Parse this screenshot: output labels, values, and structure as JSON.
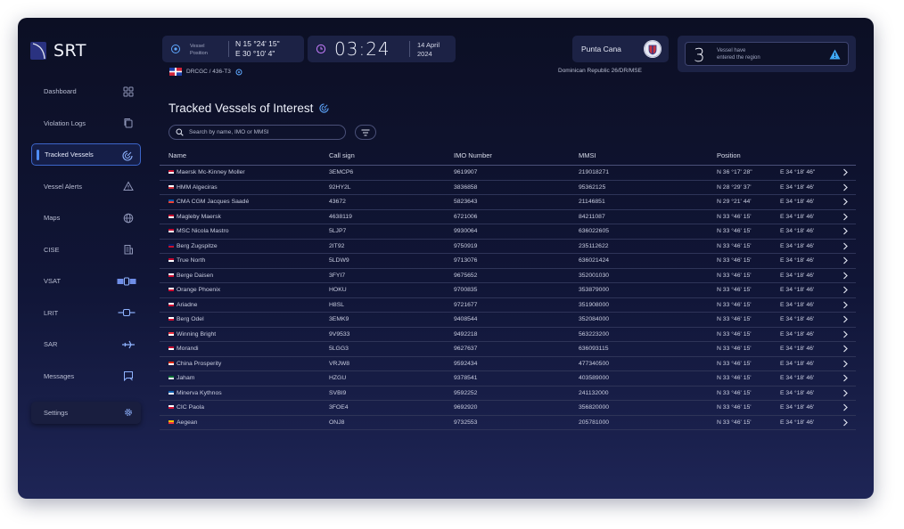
{
  "app": {
    "brand": "SRT"
  },
  "sidebar": {
    "items": [
      {
        "label": "Dashboard",
        "icon": "grid-icon"
      },
      {
        "label": "Violation Logs",
        "icon": "copy-icon"
      },
      {
        "label": "Tracked Vessels",
        "icon": "radar-icon",
        "active": true
      },
      {
        "label": "Vessel Alerts",
        "icon": "warning-icon"
      },
      {
        "label": "Maps",
        "icon": "globe-icon"
      },
      {
        "label": "CISE",
        "icon": "building-icon"
      },
      {
        "label": "VSAT",
        "icon": "satellite-icon"
      },
      {
        "label": "LRIT",
        "icon": "satellite-small-icon"
      },
      {
        "label": "SAR",
        "icon": "plane-icon"
      },
      {
        "label": "Messages",
        "icon": "message-icon"
      }
    ],
    "settings": {
      "label": "Settings",
      "icon": "gear-icon"
    }
  },
  "header": {
    "position": {
      "label_line1": "Vessel",
      "label_line2": "Position",
      "lat": "N 15 °24' 15\"",
      "lon": "E 30 °10' 4\""
    },
    "vessel_id": "DRCGC / 436-T3",
    "time": "03:24",
    "date_line1": "14 April",
    "date_line2": "2024",
    "location": "Punta Cana",
    "location_sub": "Dominican Republic 26/DR/MSE",
    "alert": {
      "count": "3",
      "line1": "Vessel have",
      "line2": "entered the region"
    }
  },
  "main": {
    "title": "Tracked Vessels of Interest",
    "search_placeholder": "Search by name, IMO or MMSI",
    "columns": {
      "name": "Name",
      "call": "Call sign",
      "imo": "IMO Number",
      "mmsi": "MMSI",
      "position": "Position"
    }
  },
  "vessels": [
    {
      "name": "Maersk Mc-Kinney Moller",
      "call": "3EMCP6",
      "imo": "9619907",
      "mmsi": "219018271",
      "lat": "N 36 °17' 28\"",
      "lon": "E 34 °18' 46\"",
      "flag": "dk"
    },
    {
      "name": "HMM Algeciras",
      "call": "92HY2L",
      "imo": "3836858",
      "mmsi": "95362125",
      "lat": "N 28 °29' 37'",
      "lon": "E 34 °18' 46'",
      "flag": "kr"
    },
    {
      "name": "CMA CGM Jacques Saadé",
      "call": "43672",
      "imo": "5823643",
      "mmsi": "21146851",
      "lat": "N 29 °21' 44'",
      "lon": "E 34 °18' 46'",
      "flag": "fr"
    },
    {
      "name": "Magleby Maersk",
      "call": "4638119",
      "imo": "6721006",
      "mmsi": "84211087",
      "lat": "N 33 °46' 15'",
      "lon": "E 34 °18' 46'",
      "flag": "dk"
    },
    {
      "name": "MSC Nicola Mastro",
      "call": "5LJP7",
      "imo": "9930064",
      "mmsi": "636022605",
      "lat": "N 33 °46' 15'",
      "lon": "E 34 °18' 46'",
      "flag": "lr"
    },
    {
      "name": "Berg Zugspitze",
      "call": "2IT92",
      "imo": "9750919",
      "mmsi": "235112622",
      "lat": "N 33 °46' 15'",
      "lon": "E 34 °18' 46'",
      "flag": "gb"
    },
    {
      "name": "True North",
      "call": "5LDW9",
      "imo": "9713076",
      "mmsi": "636021424",
      "lat": "N 33 °46' 15'",
      "lon": "E 34 °18' 46'",
      "flag": "lr"
    },
    {
      "name": "Berge Daisen",
      "call": "3FYI7",
      "imo": "9675652",
      "mmsi": "352001030",
      "lat": "N 33 °46' 15'",
      "lon": "E 34 °18' 46'",
      "flag": "pa"
    },
    {
      "name": "Orange Phoenix",
      "call": "HOKU",
      "imo": "9700835",
      "mmsi": "353879000",
      "lat": "N 33 °46' 15'",
      "lon": "E 34 °18' 46'",
      "flag": "pa"
    },
    {
      "name": "Ariadne",
      "call": "H8SL",
      "imo": "9721677",
      "mmsi": "351908000",
      "lat": "N 33 °46' 15'",
      "lon": "E 34 °18' 46'",
      "flag": "pa"
    },
    {
      "name": "Berg Odel",
      "call": "3EMK9",
      "imo": "9408544",
      "mmsi": "352084000",
      "lat": "N 33 °46' 15'",
      "lon": "E 34 °18' 46'",
      "flag": "pa"
    },
    {
      "name": "Winning Bright",
      "call": "9V9533",
      "imo": "9492218",
      "mmsi": "563223200",
      "lat": "N 33 °46' 15'",
      "lon": "E 34 °18' 46'",
      "flag": "sg"
    },
    {
      "name": "Morandi",
      "call": "5LGG3",
      "imo": "9627637",
      "mmsi": "636093115",
      "lat": "N 33 °46' 15'",
      "lon": "E 34 °18' 46'",
      "flag": "lr"
    },
    {
      "name": "China Prosperity",
      "call": "VRJW8",
      "imo": "9592434",
      "mmsi": "477340500",
      "lat": "N 33 °46' 15'",
      "lon": "E 34 °18' 46'",
      "flag": "hk"
    },
    {
      "name": "Jaham",
      "call": "HZGU",
      "imo": "9378541",
      "mmsi": "403589000",
      "lat": "N 33 °46' 15'",
      "lon": "E 34 °18' 46'",
      "flag": "sa"
    },
    {
      "name": "Minerva Kythnos",
      "call": "SVBI9",
      "imo": "9592252",
      "mmsi": "241132000",
      "lat": "N 33 °46' 15'",
      "lon": "E 34 °18' 46'",
      "flag": "gr"
    },
    {
      "name": "CIC Paola",
      "call": "3FOE4",
      "imo": "9692920",
      "mmsi": "356820000",
      "lat": "N 33 °46' 15'",
      "lon": "E 34 °18' 46'",
      "flag": "pa"
    },
    {
      "name": "Aegean",
      "call": "ONJ8",
      "imo": "9732553",
      "mmsi": "205781000",
      "lat": "N 33 °46' 15'",
      "lon": "E 34 °18' 46'",
      "flag": "be"
    }
  ],
  "colors": {
    "accent": "#4f8df7",
    "background": "#101536",
    "card": "#1c2245",
    "warning": "#3fa9f5"
  }
}
